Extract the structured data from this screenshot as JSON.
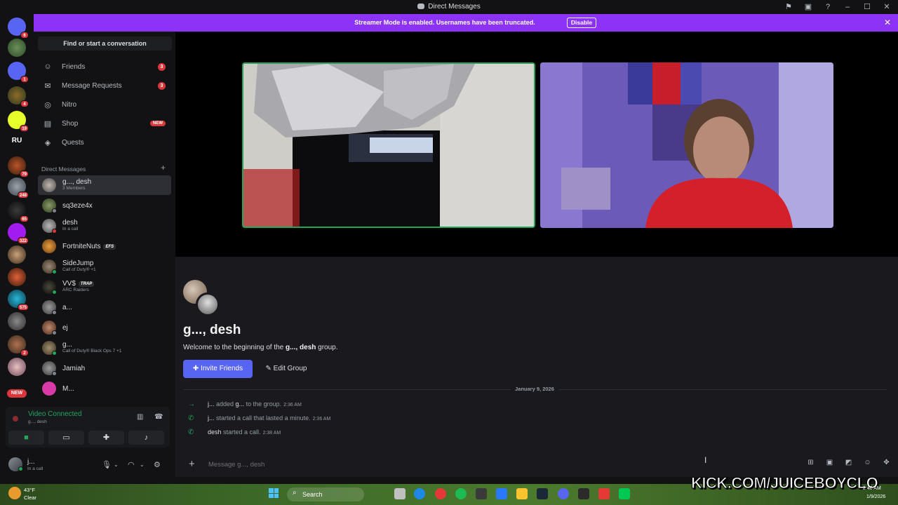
{
  "window": {
    "title": "Direct Messages"
  },
  "banner": {
    "text": "Streamer Mode is enabled. Usernames have been truncated.",
    "disable_label": "Disable"
  },
  "servers": {
    "badges": [
      "6",
      "1",
      "4",
      "19",
      "79",
      "248",
      "65",
      "322",
      "575",
      "2"
    ],
    "new_label": "NEW",
    "ru_label": "RU"
  },
  "sidebar": {
    "find_label": "Find or start a conversation",
    "nav": [
      {
        "label": "Friends",
        "icon": "friends-icon",
        "count": "3"
      },
      {
        "label": "Message Requests",
        "icon": "mail-icon",
        "count": "3"
      },
      {
        "label": "Nitro",
        "icon": "nitro-icon"
      },
      {
        "label": "Shop",
        "icon": "shop-icon",
        "badge": "NEW"
      },
      {
        "label": "Quests",
        "icon": "quests-icon"
      }
    ],
    "dm_header": "Direct Messages",
    "dms": [
      {
        "name": "g..., desh",
        "sub": "3 Members"
      },
      {
        "name": "sq3eze4x",
        "sub": ""
      },
      {
        "name": "desh",
        "sub": "In a call"
      },
      {
        "name": "FortniteNuts",
        "tag": "EFS",
        "sub": ""
      },
      {
        "name": "SideJump",
        "sub": "Call of Duty® +1"
      },
      {
        "name": "VV$",
        "tag": "TRAP",
        "sub": "ARC Raiders"
      },
      {
        "name": "a...",
        "sub": ""
      },
      {
        "name": "ej",
        "sub": ""
      },
      {
        "name": "g...",
        "sub": "Call of Duty® Black Ops 7 +1"
      },
      {
        "name": "Jamiah",
        "sub": ""
      },
      {
        "name": "M...",
        "sub": ""
      }
    ]
  },
  "voice": {
    "status": "Video Connected",
    "channel": "g..., desh"
  },
  "user": {
    "name": "j...",
    "status": "In a call"
  },
  "chat": {
    "group_title": "g..., desh",
    "welcome_prefix": "Welcome to the beginning of the ",
    "welcome_group": "g..., desh",
    "welcome_suffix": " group.",
    "invite_label": "Invite Friends",
    "edit_label": "Edit Group",
    "date_divider": "January 9, 2026",
    "system_messages": [
      {
        "who": "j...",
        "text": " added ",
        "target": "g...",
        "rest": " to the group.",
        "time": "2:36 AM"
      },
      {
        "who": "j...",
        "text": " started a call that lasted a minute.",
        "target": "",
        "rest": "",
        "time": "2:36 AM"
      },
      {
        "who": "desh",
        "text": " started a call.",
        "target": "",
        "rest": "",
        "time": "2:38 AM"
      }
    ],
    "input_placeholder": "Message g..., desh"
  },
  "taskbar": {
    "temp": "43°F",
    "condition": "Clear",
    "search_label": "Search",
    "overlay": "KICK.COM/JUICEBOYCLO",
    "time": "2:40 AM",
    "date": "1/9/2026"
  },
  "colors": {
    "accent": "#5865f2",
    "banner": "#8d33f7",
    "online": "#23a55a",
    "danger": "#da373c"
  }
}
